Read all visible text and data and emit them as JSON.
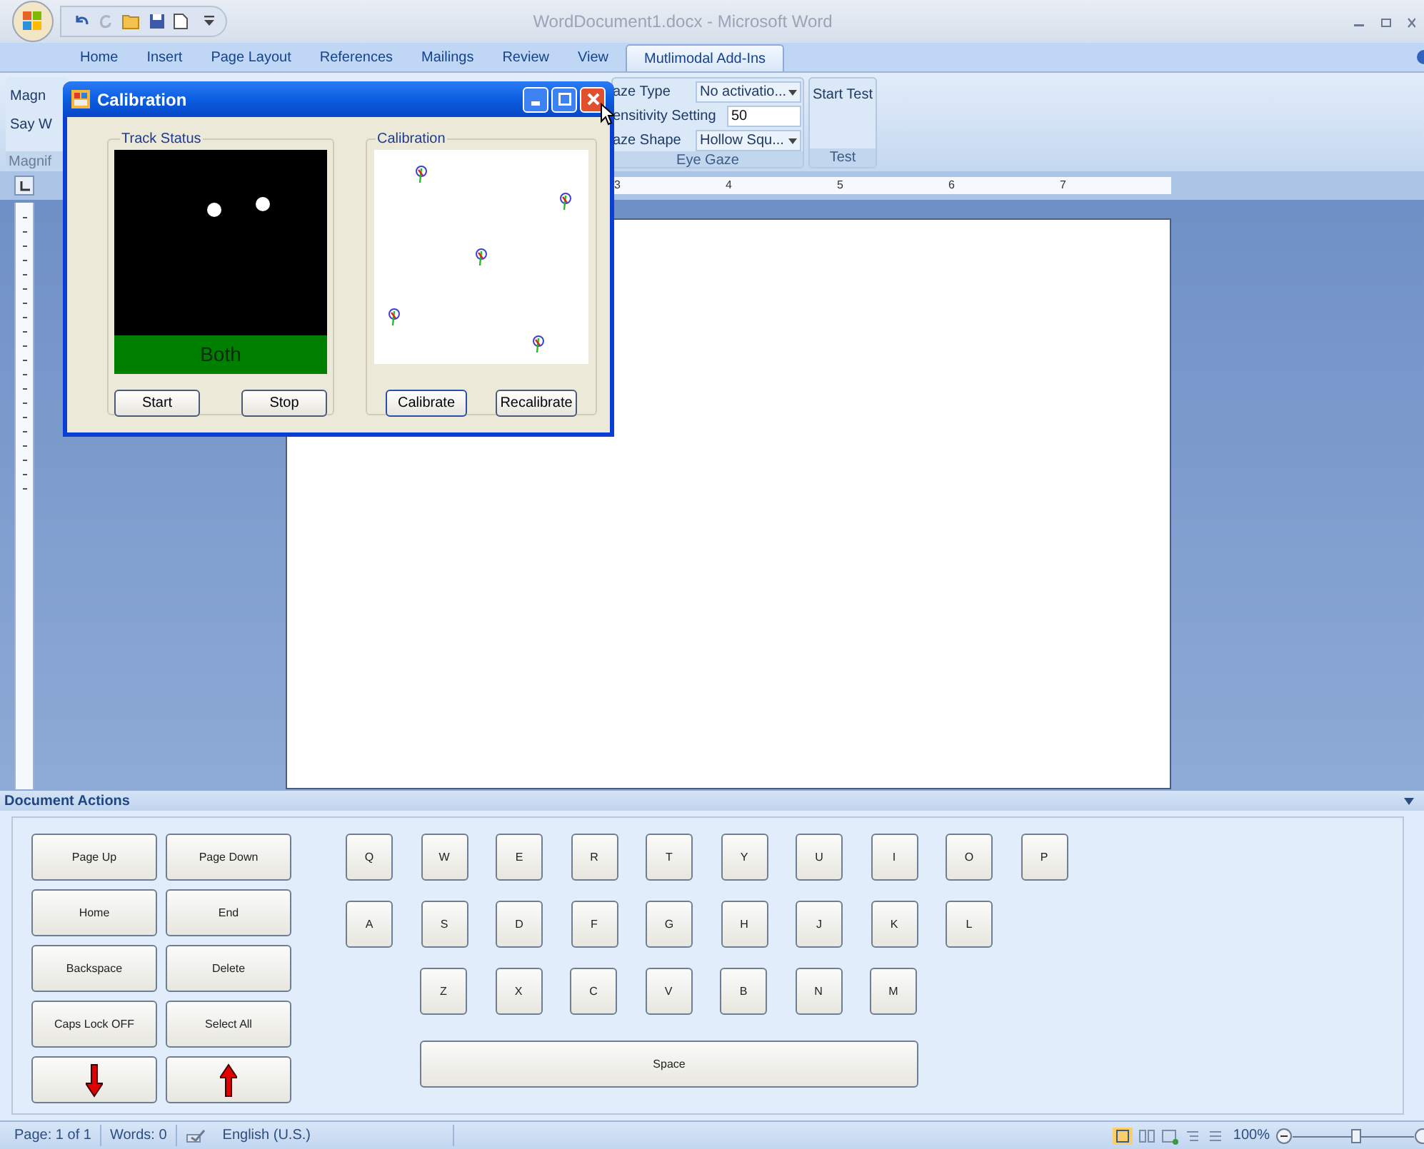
{
  "window": {
    "title": "WordDocument1.docx - Microsoft Word"
  },
  "ribbon_tabs": [
    {
      "label": "Home",
      "selected": false
    },
    {
      "label": "Insert",
      "selected": false
    },
    {
      "label": "Page Layout",
      "selected": false
    },
    {
      "label": "References",
      "selected": false
    },
    {
      "label": "Mailings",
      "selected": false
    },
    {
      "label": "Review",
      "selected": false
    },
    {
      "label": "View",
      "selected": false
    },
    {
      "label": "Mutlimodal Add-Ins",
      "selected": true
    }
  ],
  "ribbon": {
    "magnifier_group": {
      "items": [
        "Magn",
        "Say W"
      ],
      "label": "Magnif"
    },
    "eye_gaze_group": {
      "rows": [
        {
          "label": "aze Type",
          "value": "No activatio...",
          "kind": "dropdown"
        },
        {
          "label": "ensitivity Setting",
          "value": "50",
          "kind": "text"
        },
        {
          "label": "aze Shape",
          "value": "Hollow Squ...",
          "kind": "dropdown"
        }
      ],
      "label": "Eye Gaze"
    },
    "test_group": {
      "button": "Start Test",
      "label": "Test"
    }
  },
  "ruler": {
    "numbers": [
      "3",
      "4",
      "5",
      "6",
      "7"
    ]
  },
  "calibration_dialog": {
    "title": "Calibration",
    "track_status": {
      "title": "Track Status",
      "status": "Both",
      "buttons": [
        "Start",
        "Stop"
      ]
    },
    "calibration": {
      "title": "Calibration",
      "buttons": [
        "Calibrate",
        "Recalibrate"
      ]
    }
  },
  "document_actions": {
    "title": "Document Actions",
    "nav_buttons": [
      {
        "kind": "text",
        "label": "Page Up"
      },
      {
        "kind": "text",
        "label": "Page Down"
      },
      {
        "kind": "text",
        "label": "Home"
      },
      {
        "kind": "text",
        "label": "End"
      },
      {
        "kind": "text",
        "label": "Backspace"
      },
      {
        "kind": "text",
        "label": "Delete"
      },
      {
        "kind": "text",
        "label": "Caps Lock OFF"
      },
      {
        "kind": "text",
        "label": "Select All"
      },
      {
        "kind": "down_arrow"
      },
      {
        "kind": "up_arrow"
      }
    ],
    "keyboard_rows": [
      [
        "Q",
        "W",
        "E",
        "R",
        "T",
        "Y",
        "U",
        "I",
        "O",
        "P"
      ],
      [
        "A",
        "S",
        "D",
        "F",
        "G",
        "H",
        "J",
        "K",
        "L"
      ],
      [
        "Z",
        "X",
        "C",
        "V",
        "B",
        "N",
        "M"
      ]
    ],
    "space": "Space"
  },
  "status_bar": {
    "page": "Page: 1 of 1",
    "words": "Words: 0",
    "language": "English (U.S.)",
    "zoom": "100%",
    "zoom_slider": {
      "level": 0.53
    }
  }
}
